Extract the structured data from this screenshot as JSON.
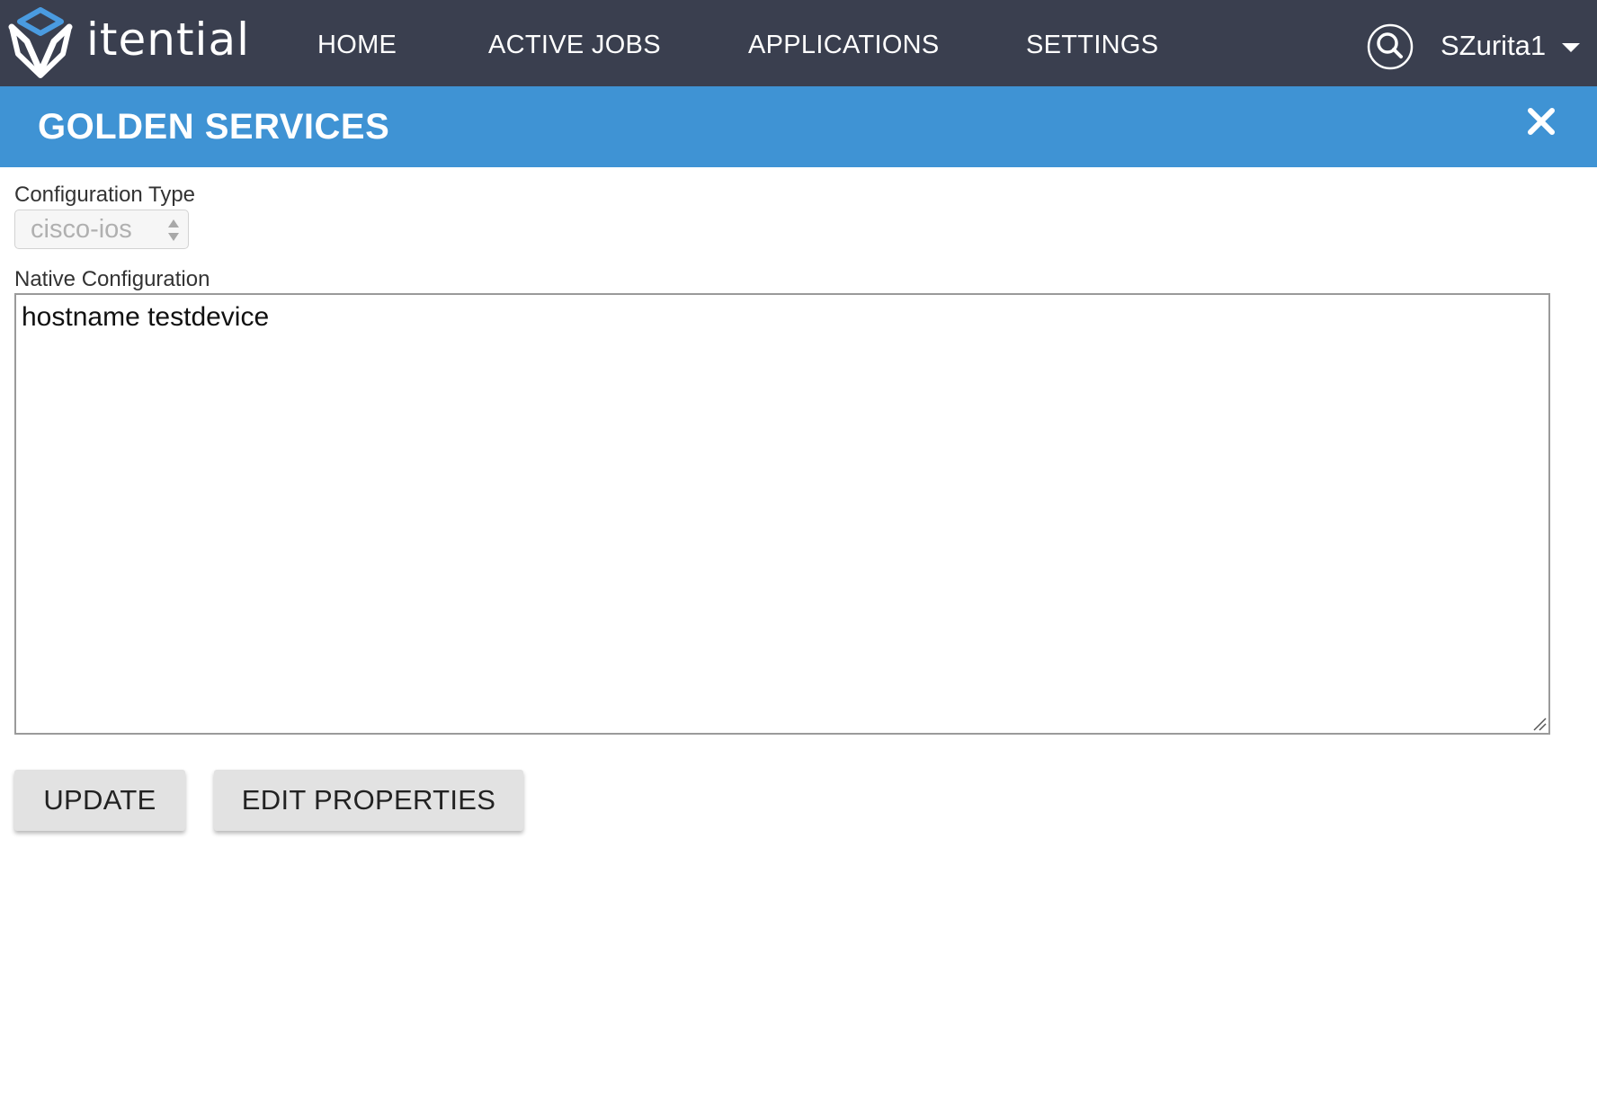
{
  "app": {
    "brand": "itential"
  },
  "nav": {
    "items": [
      {
        "label": "HOME"
      },
      {
        "label": "ACTIVE JOBS"
      },
      {
        "label": "APPLICATIONS"
      },
      {
        "label": "SETTINGS"
      }
    ],
    "search_icon": "search-icon",
    "user": {
      "name": "SZurita1",
      "menu_icon": "chevron-down-icon"
    }
  },
  "banner": {
    "title": "GOLDEN SERVICES",
    "close_icon": "close-icon",
    "color": "#3f93d4"
  },
  "form": {
    "config_type": {
      "label": "Configuration Type",
      "value": "cisco-ios",
      "disabled": true
    },
    "native_config": {
      "label": "Native Configuration",
      "value": "hostname testdevice"
    }
  },
  "actions": {
    "update_label": "UPDATE",
    "edit_properties_label": "EDIT PROPERTIES"
  },
  "colors": {
    "topbar": "#3a3f4f",
    "accent": "#3f93d4",
    "button": "#e2e2e2"
  }
}
